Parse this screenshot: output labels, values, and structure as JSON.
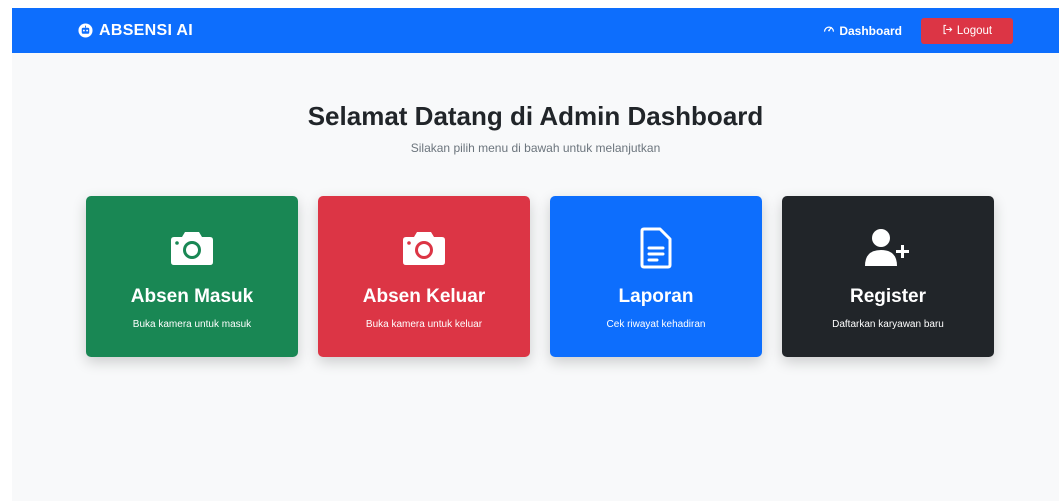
{
  "navbar": {
    "brand": "ABSENSI AI",
    "brand_icon": "robot-icon",
    "dashboard_label": "Dashboard",
    "dashboard_icon": "speedometer-icon",
    "logout_label": "Logout",
    "logout_icon": "logout-icon"
  },
  "hero": {
    "title": "Selamat Datang di Admin Dashboard",
    "subtitle": "Silakan pilih menu di bawah untuk melanjutkan"
  },
  "cards": [
    {
      "title": "Absen Masuk",
      "subtitle": "Buka kamera untuk masuk",
      "icon": "camera-icon",
      "color": "#198754"
    },
    {
      "title": "Absen Keluar",
      "subtitle": "Buka kamera untuk keluar",
      "icon": "camera-icon",
      "color": "#dc3545"
    },
    {
      "title": "Laporan",
      "subtitle": "Cek riwayat kehadiran",
      "icon": "document-icon",
      "color": "#0d6efd"
    },
    {
      "title": "Register",
      "subtitle": "Daftarkan karyawan baru",
      "icon": "user-plus-icon",
      "color": "#212529"
    }
  ],
  "colors": {
    "navbar": "#0d6efd",
    "background": "#f8f9fa",
    "logout": "#dc3545"
  }
}
